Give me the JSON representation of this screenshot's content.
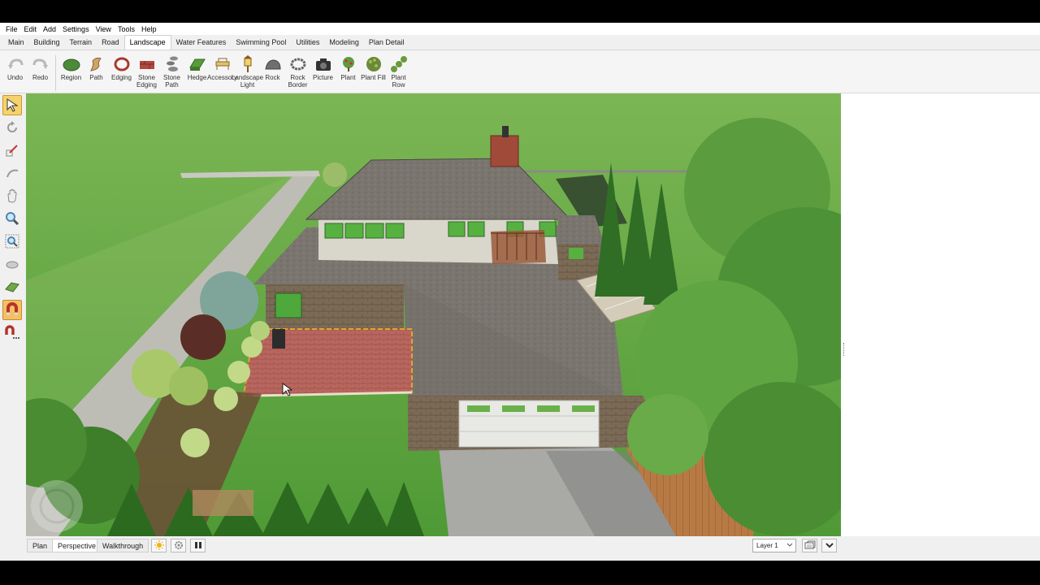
{
  "menu": [
    "File",
    "Edit",
    "Add",
    "Settings",
    "View",
    "Tools",
    "Help"
  ],
  "tabs": [
    {
      "label": "Main",
      "active": false
    },
    {
      "label": "Building",
      "active": false
    },
    {
      "label": "Terrain",
      "active": false
    },
    {
      "label": "Road",
      "active": false
    },
    {
      "label": "Landscape",
      "active": true
    },
    {
      "label": "Water Features",
      "active": false
    },
    {
      "label": "Swimming Pool",
      "active": false
    },
    {
      "label": "Utilities",
      "active": false
    },
    {
      "label": "Modeling",
      "active": false
    },
    {
      "label": "Plan Detail",
      "active": false
    }
  ],
  "toolbar": {
    "undo": "Undo",
    "redo": "Redo",
    "region": "Region",
    "path": "Path",
    "edging": "Edging",
    "stone_edging": "Stone Edging",
    "stone_path": "Stone Path",
    "hedge": "Hedge",
    "accessory": "Accessory",
    "landscape_light": "Landscape Light",
    "rock": "Rock",
    "rock_border": "Rock Border",
    "picture": "Picture",
    "plant": "Plant",
    "plant_fill": "Plant Fill",
    "plant_row": "Plant Row"
  },
  "left_tools": [
    "select-arrow-icon",
    "rotate-icon",
    "resize-icon",
    "orbit-icon",
    "pan-hand-icon",
    "zoom-icon",
    "zoom-box-icon",
    "view-rotate-icon",
    "terrain-tool-icon",
    "magnet-icon",
    "magnet-options-icon"
  ],
  "view_tabs": {
    "plan": "Plan",
    "perspective": "Perspective",
    "walkthrough": "Walkthrough",
    "active": "Perspective"
  },
  "layer": {
    "value": "Layer 1"
  },
  "colors": {
    "accent": "#f6d26a",
    "grass": "#6fb04a",
    "roof": "#77726c",
    "patio": "#b0625c"
  }
}
